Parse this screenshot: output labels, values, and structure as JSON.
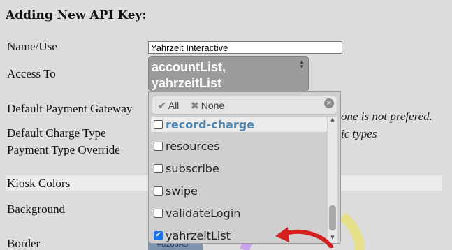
{
  "form": {
    "heading": "Adding New API Key:",
    "labels": {
      "name": "Name/Use",
      "access": "Access To",
      "gateway": "Default Payment Gateway",
      "charge_type": "Default Charge Type",
      "override": "Payment Type Override",
      "kiosk": "Kiosk Colors",
      "background": "Background",
      "border": "Border"
    },
    "name_value": "Yahrzeit Interactive",
    "gateway_hint": "one is not prefered.",
    "charge_type_hint": "ic types",
    "border_color_value": "#0266A5"
  },
  "access_select": {
    "line1": "accountList,",
    "line2": "yahrzeitList"
  },
  "dropdown": {
    "all_label": "All",
    "none_label": "None",
    "options": [
      {
        "label": "record-charge",
        "checked": false,
        "highlighted": true
      },
      {
        "label": "resources",
        "checked": false,
        "highlighted": false
      },
      {
        "label": "subscribe",
        "checked": false,
        "highlighted": false
      },
      {
        "label": "swipe",
        "checked": false,
        "highlighted": false
      },
      {
        "label": "validateLogin",
        "checked": false,
        "highlighted": false
      },
      {
        "label": "yahrzeitList",
        "checked": true,
        "highlighted": false
      }
    ]
  },
  "colors": {
    "annotation_arrow": "#d42020",
    "checkbox_checked": "#1a73e8"
  }
}
